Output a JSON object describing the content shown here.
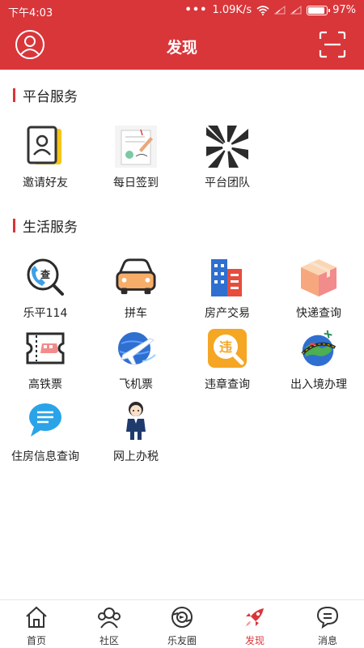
{
  "status": {
    "time": "下午4:03",
    "dots": "•••",
    "speed": "1.09K/s",
    "battery": "97%"
  },
  "header": {
    "title": "发现"
  },
  "sections": {
    "platform": {
      "title": "平台服务",
      "items": [
        "邀请好友",
        "每日签到",
        "平台团队"
      ]
    },
    "life": {
      "title": "生活服务",
      "items": [
        "乐平114",
        "拼车",
        "房产交易",
        "快递查询",
        "高铁票",
        "飞机票",
        "违章查询",
        "出入境办理",
        "住房信息查询",
        "网上办税"
      ]
    }
  },
  "nav": {
    "items": [
      "首页",
      "社区",
      "乐友圈",
      "发现",
      "消息"
    ],
    "active": "发现"
  },
  "colors": {
    "brand": "#d9363a"
  }
}
